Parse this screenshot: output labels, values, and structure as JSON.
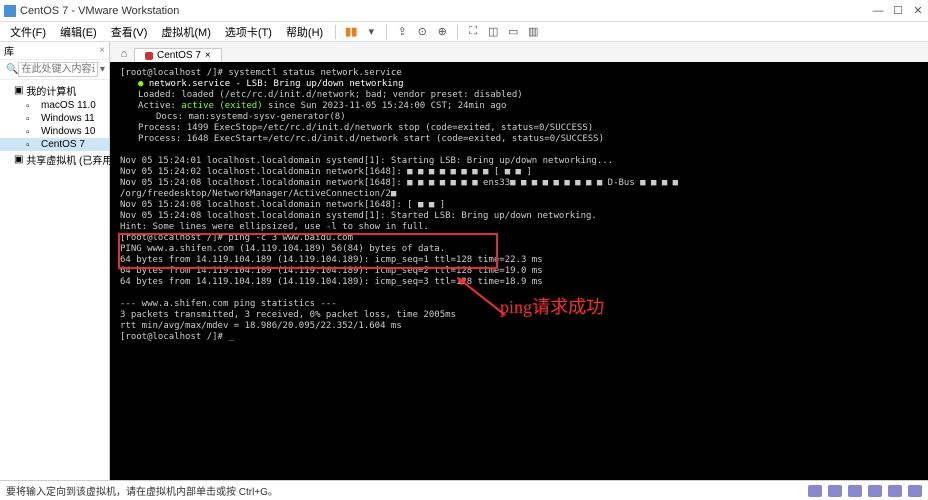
{
  "titlebar": {
    "title": "CentOS 7 - VMware Workstation"
  },
  "menubar": {
    "items": [
      "文件(F)",
      "编辑(E)",
      "查看(V)",
      "虚拟机(M)",
      "选项卡(T)",
      "帮助(H)"
    ]
  },
  "sidebar": {
    "header": "库",
    "search_placeholder": "在此处键入内容进行搜索",
    "root": "我的计算机",
    "items": [
      "macOS 11.0",
      "Windows 11",
      "Windows 10",
      "CentOS 7"
    ],
    "shared": "共享虚拟机 (已弃用)"
  },
  "tab": {
    "label": "CentOS 7"
  },
  "terminal": {
    "l0": "[root@localhost /]# systemctl status network.service",
    "l1": "network.service - LSB: Bring up/down networking",
    "l2": "Loaded: loaded (/etc/rc.d/init.d/network; bad; vendor preset: disabled)",
    "l3a": "Active: ",
    "l3b": "active (exited)",
    "l3c": " since Sun 2023-11-05 15:24:00 CST; 24min ago",
    "l4": "Docs: man:systemd-sysv-generator(8)",
    "l5": "Process: 1499 ExecStop=/etc/rc.d/init.d/network stop (code=exited, status=0/SUCCESS)",
    "l6": "Process: 1648 ExecStart=/etc/rc.d/init.d/network start (code=exited, status=0/SUCCESS)",
    "l7": "Nov 05 15:24:01 localhost.localdomain systemd[1]: Starting LSB: Bring up/down networking...",
    "l8": "Nov 05 15:24:02 localhost.localdomain network[1648]: ■ ■ ■ ■ ■ ■ ■ ■  [  ■ ■   ]",
    "l9": "Nov 05 15:24:08 localhost.localdomain network[1648]: ■ ■ ■ ■ ■ ■ ■  ens33■  ■ ■ ■ ■ ■ ■ ■ ■  D-Bus ■ ■ ■ ■  /org/freedesktop/NetworkManager/ActiveConnection/2■",
    "l10": "Nov 05 15:24:08 localhost.localdomain network[1648]: [  ■ ■   ]",
    "l11": "Nov 05 15:24:08 localhost.localdomain systemd[1]: Started LSB: Bring up/down networking.",
    "l12": "Hint: Some lines were ellipsized, use -l to show in full.",
    "l13": "[root@localhost /]# ping -c 3 www.baidu.com",
    "l14": "PING www.a.shifen.com (14.119.104.189) 56(84) bytes of data.",
    "l15": "64 bytes from 14.119.104.189 (14.119.104.189): icmp_seq=1 ttl=128 time=22.3 ms",
    "l16": "64 bytes from 14.119.104.189 (14.119.104.189): icmp_seq=2 ttl=128 time=19.0 ms",
    "l17": "64 bytes from 14.119.104.189 (14.119.104.189): icmp_seq=3 ttl=128 time=18.9 ms",
    "l18": "--- www.a.shifen.com ping statistics ---",
    "l19": "3 packets transmitted, 3 received, 0% packet loss, time 2005ms",
    "l20": "rtt min/avg/max/mdev = 18.986/20.095/22.352/1.604 ms",
    "l21": "[root@localhost /]# _"
  },
  "annotation": {
    "text": "ping请求成功"
  },
  "statusbar": {
    "text": "要将输入定向到该虚拟机，请在虚拟机内部单击或按 Ctrl+G。"
  }
}
